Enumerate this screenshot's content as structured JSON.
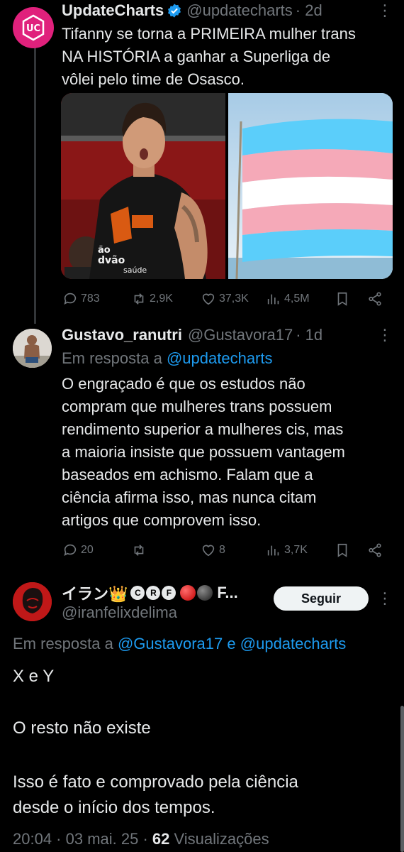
{
  "tweet1": {
    "name": "UpdateCharts",
    "handle": "@updatecharts",
    "time": "· 2d",
    "lines": [
      "Tifanny se torna a PRIMEIRA mulher trans",
      "NA HISTÓRIA a ganhar a Superliga de",
      "vôlei pelo time de Osasco."
    ],
    "photo_jersey_lines": [
      "ão",
      "dvão",
      "saúde"
    ],
    "stats": {
      "replies": "783",
      "reposts": "2,9K",
      "likes": "37,3K",
      "views": "4,5M"
    }
  },
  "tweet2": {
    "name": "Gustavo_ranutri",
    "handle": "@Gustavora17",
    "time": "· 1d",
    "reply_prefix": "Em resposta a",
    "reply_to": "@updatecharts",
    "lines": [
      "O engraçado é que os estudos não",
      "compram que mulheres trans possuem",
      "rendimento superior a mulheres cis, mas",
      "a maioria insiste que possuem vantagem",
      "baseados em achismo. Falam que a",
      "ciência afirma isso, mas nunca citam",
      "artigos que comprovem isso."
    ],
    "stats": {
      "replies": "20",
      "reposts": "",
      "likes": "8",
      "views": "3,7K"
    }
  },
  "tweet3": {
    "name": "イラン👑",
    "badges": [
      "C",
      "R",
      "F"
    ],
    "name_suffix": "F...",
    "handle": "@iranfelixdelima",
    "follow_label": "Seguir",
    "reply_prefix": "Em resposta a",
    "reply_to_1": "@Gustavora17",
    "reply_and": "e",
    "reply_to_2": "@updatecharts",
    "line1": "X e Y",
    "line2": "O resto não existe",
    "line3a": "Isso é fato e comprovado pela ciência",
    "line3b": "desde o início dos tempos.",
    "time": "20:04 · 03 mai. 25 ·",
    "views_count": "62",
    "views_label": "Visualizações"
  },
  "colors": {
    "background": "#000000",
    "text": "#e7e9ea",
    "secondary": "#71767b",
    "link": "#1d9bf0",
    "brand_pink": "#e0217c",
    "trans_blue": "#5bcefa",
    "trans_pink": "#f5a9b8"
  }
}
